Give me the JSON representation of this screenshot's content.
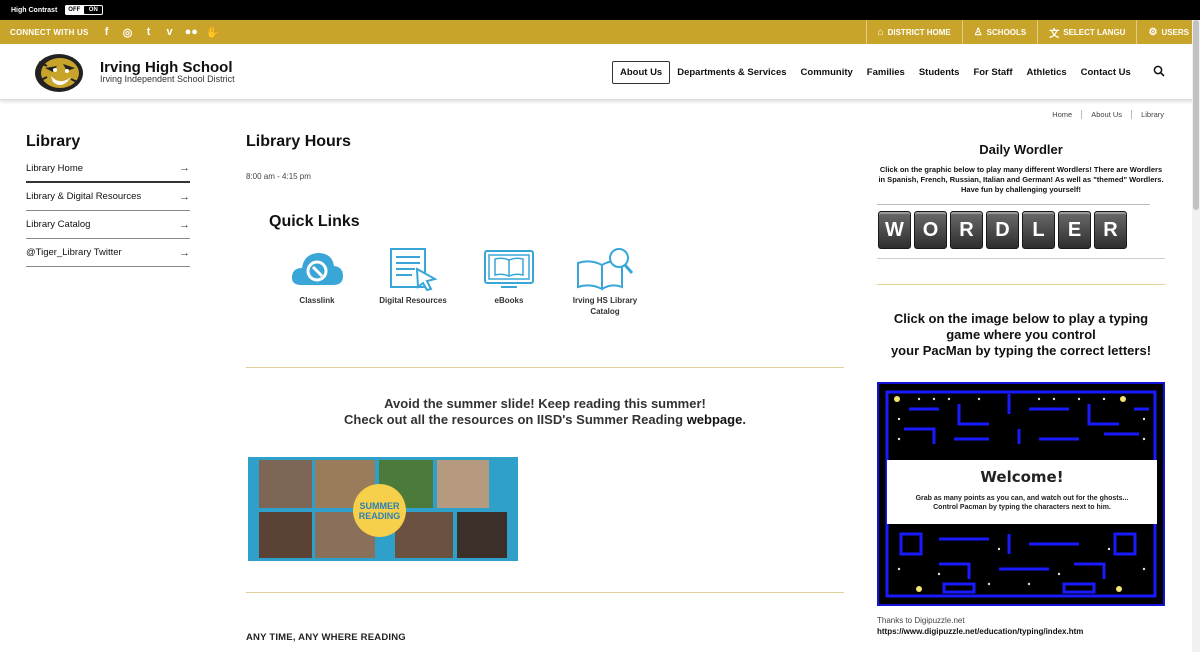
{
  "high_contrast": {
    "label": "High Contrast",
    "off": "OFF",
    "on": "ON"
  },
  "topbar": {
    "connect": "CONNECT WITH US",
    "social": [
      "f",
      "◎",
      "t",
      "v",
      "●●",
      "✋"
    ],
    "district_home": "DISTRICT HOME",
    "schools": "SCHOOLS",
    "language": "SELECT LANGU",
    "users": "USERS"
  },
  "header": {
    "school": "Irving High School",
    "district": "Irving Independent School District",
    "nav": [
      "About Us",
      "Departments & Services",
      "Community",
      "Families",
      "Students",
      "For Staff",
      "Athletics",
      "Contact Us"
    ]
  },
  "sidebar": {
    "title": "Library",
    "items": [
      {
        "label": "Library Home",
        "arrow": "→"
      },
      {
        "label": "Library & Digital Resources",
        "arrow": "→"
      },
      {
        "label": "Library Catalog",
        "arrow": "→"
      },
      {
        "label": "@Tiger_Library Twitter",
        "arrow": "→"
      }
    ]
  },
  "main": {
    "title": "Library Hours",
    "hours": "8:00 am - 4:15 pm",
    "quick_links_title": "Quick Links",
    "quick_links": [
      {
        "label": "Classlink",
        "icon": "classlink-cloud-icon"
      },
      {
        "label": "Digital Resources",
        "icon": "digital-resources-icon"
      },
      {
        "label": "eBooks",
        "icon": "ebook-icon"
      },
      {
        "label": "Irving HS Library Catalog",
        "icon": "library-catalog-icon"
      }
    ],
    "summer_line1": "Avoid the summer slide! Keep reading this summer!",
    "summer_line2": "Check out all the resources on IISD's Summer Reading",
    "summer_link": "webpage",
    "summer_period": ".",
    "summer_badge": "SUMMER READING",
    "anytime": "ANY TIME, ANY WHERE READING"
  },
  "breadcrumb": [
    "Home",
    "About Us",
    "Library"
  ],
  "right": {
    "wordler_title": "Daily Wordler",
    "wordler_desc": "Click on the graphic below to play many different Wordlers! There are Wordlers in Spanish, French, Russian, Italian and German! As well as \"themed\" Wordlers. Have fun by challenging yourself!",
    "wordler_letters": [
      "W",
      "O",
      "R",
      "D",
      "L",
      "E",
      "R"
    ],
    "typing_title_1": "Click on the image below to play a typing game where you control",
    "typing_title_2": "your PacMan by typing the correct letters!",
    "welcome_title": "Welcome!",
    "welcome_text_1": "Grab as many points as you can, and watch out for the ghosts...",
    "welcome_text_2": "Control Pacman by typing the characters next to him.",
    "thanks": "Thanks to Digipuzzle.net",
    "thanks_url": "https://www.digipuzzle.net/education/typing/index.htm"
  }
}
